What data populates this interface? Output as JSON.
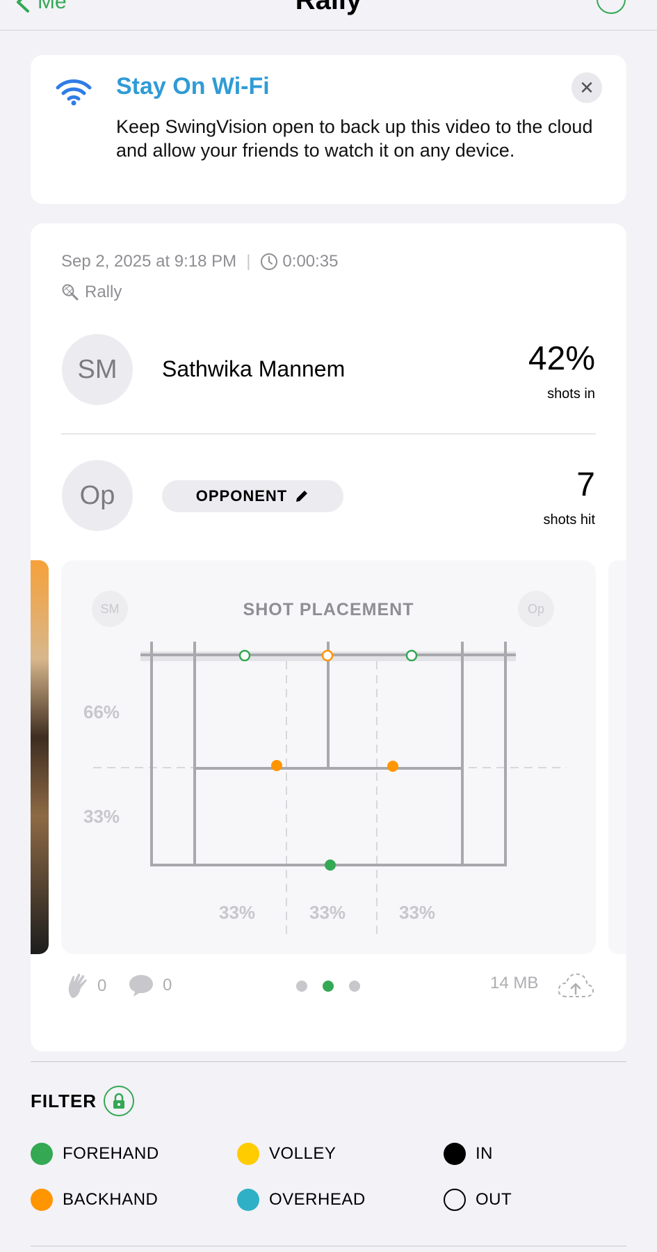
{
  "nav": {
    "back_label": "Me",
    "title": "Rally"
  },
  "wifi_banner": {
    "title": "Stay On Wi-Fi",
    "body": "Keep SwingVision open to back up this video to the cloud and allow your friends to watch it on any device.",
    "close_glyph": "✕"
  },
  "session": {
    "date": "Sep 2, 2025 at 9:18 PM",
    "separator": "|",
    "duration": "0:00:35",
    "type": "Rally"
  },
  "player": {
    "initials": "SM",
    "name": "Sathwika Mannem",
    "stat_value": "42%",
    "stat_label": "shots in"
  },
  "opponent": {
    "initials": "Op",
    "label": "OPPONENT",
    "stat_value": "7",
    "stat_label": "shots hit"
  },
  "court": {
    "title": "SHOT PLACEMENT",
    "chip_left": "SM",
    "chip_right": "Op",
    "depth_labels": [
      "66%",
      "33%"
    ],
    "width_labels": [
      "33%",
      "33%",
      "33%"
    ]
  },
  "footer": {
    "likes": "0",
    "comments": "0",
    "size": "14 MB",
    "page_count": 3,
    "active_page": 2
  },
  "filter": {
    "label": "FILTER",
    "legend": [
      {
        "label": "FOREHAND",
        "color": "#34a853",
        "style": "fill"
      },
      {
        "label": "VOLLEY",
        "color": "#ffcc00",
        "style": "fill"
      },
      {
        "label": "IN",
        "color": "#000000",
        "style": "fill"
      },
      {
        "label": "BACKHAND",
        "color": "#ff9500",
        "style": "fill"
      },
      {
        "label": "OVERHEAD",
        "color": "#30b0c7",
        "style": "fill"
      },
      {
        "label": "OUT",
        "color": "#000000",
        "style": "outline"
      }
    ]
  },
  "colors": {
    "accent": "#34a853",
    "link": "#2f9bd6",
    "backhand": "#ff9500"
  }
}
